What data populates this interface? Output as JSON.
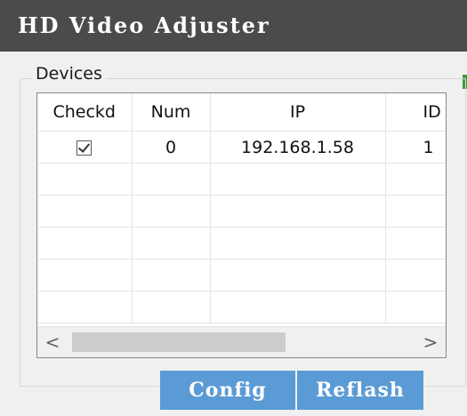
{
  "window": {
    "title": "HD Video Adjuster"
  },
  "devices_group": {
    "legend": "Devices",
    "columns": [
      "Checkd",
      "Num",
      "IP",
      "ID"
    ],
    "rows": [
      {
        "checked": true,
        "num": "0",
        "ip": "192.168.1.58",
        "id": "1"
      }
    ],
    "scrollbar": {
      "left_arrow": "<",
      "right_arrow": ">"
    }
  },
  "buttons": {
    "config": "Config",
    "reflash": "Reflash"
  },
  "colors": {
    "titlebar": "#4b4b4b",
    "button": "#5b9bd5",
    "window_bg": "#f0f0f0"
  }
}
